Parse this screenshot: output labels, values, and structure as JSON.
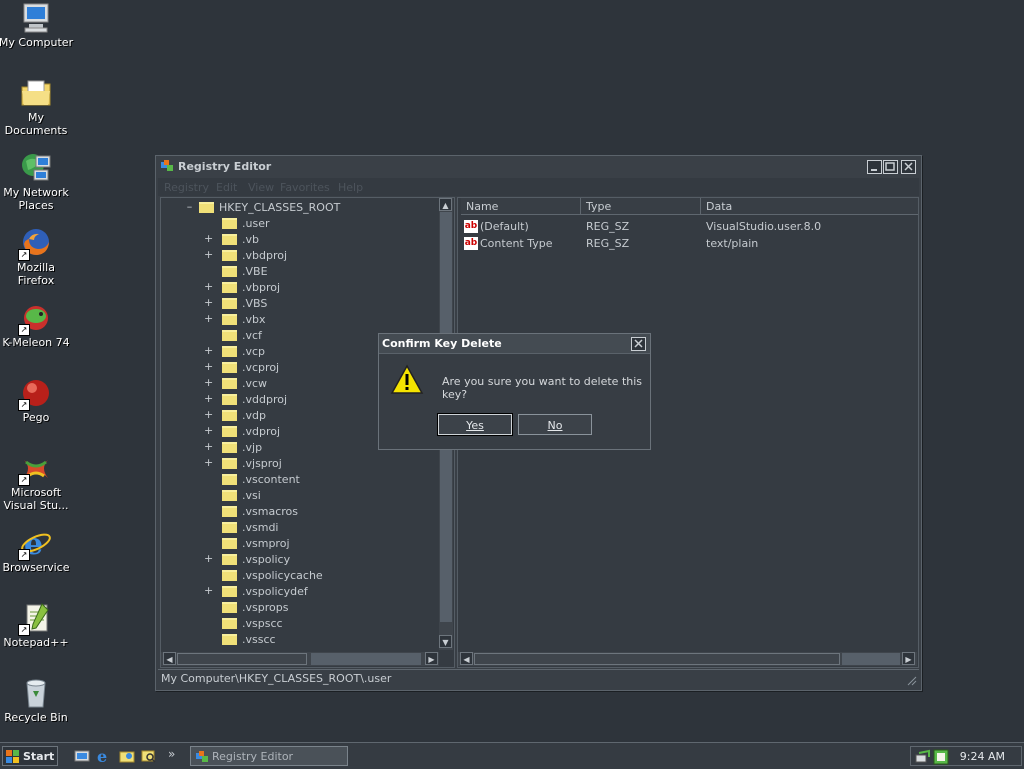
{
  "desktop": {
    "icons": [
      {
        "label": "My Computer",
        "icon": "my-computer-icon"
      },
      {
        "label": "My Documents",
        "icon": "my-documents-icon"
      },
      {
        "label": "My Network Places",
        "icon": "network-places-icon"
      },
      {
        "label": "Mozilla Firefox",
        "icon": "firefox-icon"
      },
      {
        "label": "K-Meleon 74",
        "icon": "k-meleon-icon"
      },
      {
        "label": "Pego",
        "icon": "pego-icon"
      },
      {
        "label": "Microsoft Visual Stu...",
        "icon": "visual-studio-icon"
      },
      {
        "label": "Browservice",
        "icon": "internet-explorer-icon"
      },
      {
        "label": "Notepad++",
        "icon": "notepad-plus-plus-icon"
      },
      {
        "label": "Recycle Bin",
        "icon": "recycle-bin-icon"
      }
    ]
  },
  "window": {
    "title": "Registry Editor",
    "menu": [
      "Registry",
      "Edit",
      "View",
      "Favorites",
      "Help"
    ],
    "tree": {
      "root": "HKEY_CLASSES_ROOT",
      "root_expander": "–",
      "items": [
        {
          "name": ".user",
          "expander": ""
        },
        {
          "name": ".vb",
          "expander": "+"
        },
        {
          "name": ".vbdproj",
          "expander": "+"
        },
        {
          "name": ".VBE",
          "expander": ""
        },
        {
          "name": ".vbproj",
          "expander": "+"
        },
        {
          "name": ".VBS",
          "expander": "+"
        },
        {
          "name": ".vbx",
          "expander": "+"
        },
        {
          "name": ".vcf",
          "expander": ""
        },
        {
          "name": ".vcp",
          "expander": "+"
        },
        {
          "name": ".vcproj",
          "expander": "+"
        },
        {
          "name": ".vcw",
          "expander": "+"
        },
        {
          "name": ".vddproj",
          "expander": "+"
        },
        {
          "name": ".vdp",
          "expander": "+"
        },
        {
          "name": ".vdproj",
          "expander": "+"
        },
        {
          "name": ".vjp",
          "expander": "+"
        },
        {
          "name": ".vjsproj",
          "expander": "+"
        },
        {
          "name": ".vscontent",
          "expander": ""
        },
        {
          "name": ".vsi",
          "expander": ""
        },
        {
          "name": ".vsmacros",
          "expander": ""
        },
        {
          "name": ".vsmdi",
          "expander": ""
        },
        {
          "name": ".vsmproj",
          "expander": ""
        },
        {
          "name": ".vspolicy",
          "expander": "+"
        },
        {
          "name": ".vspolicycache",
          "expander": ""
        },
        {
          "name": ".vspolicydef",
          "expander": "+"
        },
        {
          "name": ".vsprops",
          "expander": ""
        },
        {
          "name": ".vspscc",
          "expander": ""
        },
        {
          "name": ".vsscc",
          "expander": ""
        }
      ]
    },
    "values": {
      "columns": [
        "Name",
        "Type",
        "Data"
      ],
      "rows": [
        {
          "name": "(Default)",
          "type": "REG_SZ",
          "data": "VisualStudio.user.8.0"
        },
        {
          "name": "Content Type",
          "type": "REG_SZ",
          "data": "text/plain"
        }
      ]
    },
    "status": "My Computer\\HKEY_CLASSES_ROOT\\.user"
  },
  "dialog": {
    "title": "Confirm Key Delete",
    "message": "Are you sure you want to delete this key?",
    "yes_label": "Yes",
    "no_label": "No"
  },
  "taskbar": {
    "start_label": "Start",
    "task_label": "Registry Editor",
    "overflow": "»",
    "clock": "9:24 AM"
  },
  "colors": {
    "desktop": "#2e343b",
    "folder": "#f0e078"
  }
}
